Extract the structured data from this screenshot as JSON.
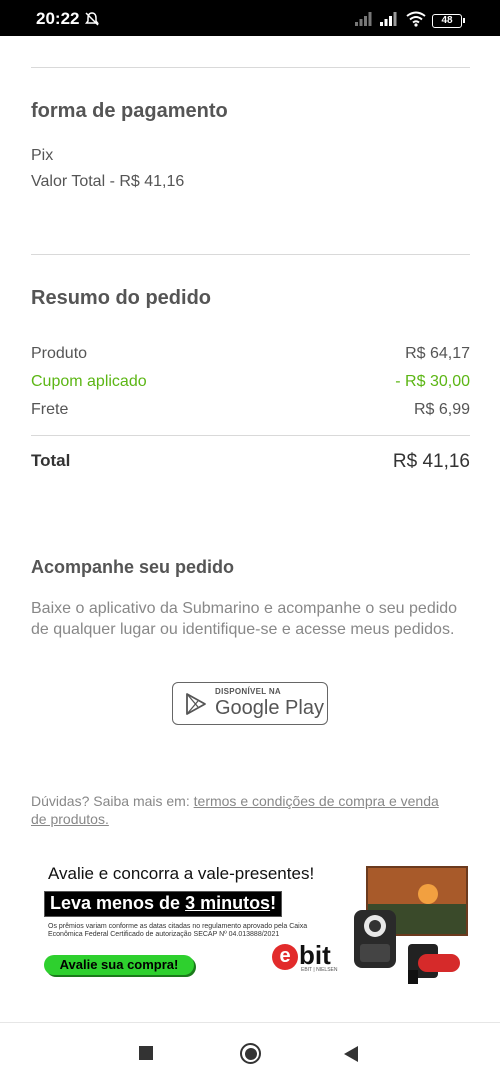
{
  "status_bar": {
    "time": "20:22",
    "battery": "48",
    "icons": [
      "mute-icon",
      "signal-icon",
      "signal-icon",
      "wifi-icon",
      "battery-icon"
    ]
  },
  "payment": {
    "title": "forma de pagamento",
    "method": "Pix",
    "total_line": "Valor Total - R$ 41,16"
  },
  "summary": {
    "title": "Resumo do pedido",
    "rows": [
      {
        "label": "Produto",
        "value": "R$ 64,17"
      },
      {
        "label": "Cupom aplicado",
        "value": "- R$ 30,00"
      },
      {
        "label": "Frete",
        "value": "R$ 6,99"
      }
    ],
    "total_label": "Total",
    "total_value": "R$ 41,16",
    "coupon_color": "#5cb615"
  },
  "tracking": {
    "title": "Acompanhe seu pedido",
    "text": "Baixe o aplicativo da Submarino e acompanhe o seu pedido de qualquer lugar ou identifique-se e acesse meus pedidos.",
    "store_badge_small": "DISPONÍVEL NA",
    "store_badge_big": "Google Play"
  },
  "help": {
    "prefix": "Dúvidas? Saiba mais em: ",
    "link": "termos e condições de compra e venda de produtos."
  },
  "banner": {
    "title": "Avalie e concorra a vale-presentes!",
    "highlight_prefix": "Leva menos de ",
    "highlight_emph": "3 minutos",
    "highlight_suffix": "!",
    "fine_print": "Os prêmios variam conforme as datas citadas no regulamento aprovado pela Caixa Econômica Federal Certificado de autorização SECAP Nº 04.013888/2021",
    "button": "Avalie sua compra!",
    "logo_e": "e",
    "logo_bit": "bit",
    "logo_sub": "EBIT | NIELSEN",
    "button_color": "#2ed02e"
  },
  "nav": {
    "icons": [
      "recent-apps-icon",
      "home-icon",
      "back-icon"
    ]
  }
}
